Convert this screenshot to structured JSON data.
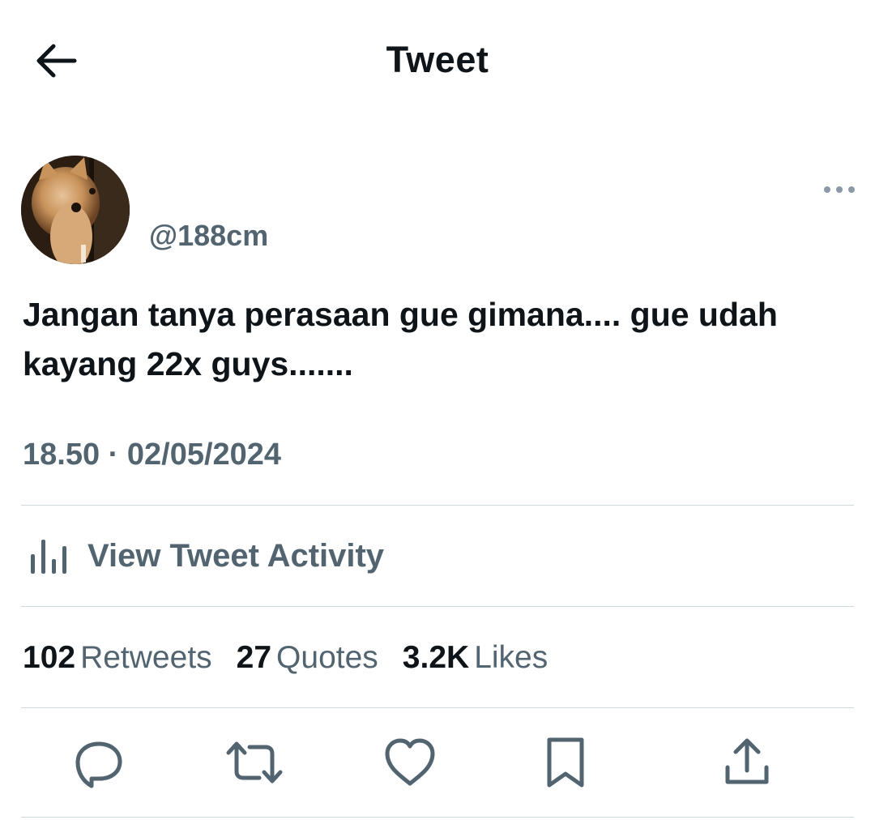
{
  "header": {
    "title": "Tweet",
    "back_icon": "arrow-left-icon"
  },
  "author": {
    "handle": "@188cm",
    "avatar": "cat-photo-avatar",
    "more_icon": "more-horizontal-icon"
  },
  "tweet": {
    "text": "Jangan tanya perasaan gue gimana.... gue udah kayang 22x guys.......",
    "timestamp": "18.50 · 02/05/2024"
  },
  "activity": {
    "label": "View Tweet Activity",
    "icon": "analytics-bars-icon"
  },
  "stats": {
    "retweets_count": "102",
    "retweets_label": "Retweets",
    "quotes_count": "27",
    "quotes_label": "Quotes",
    "likes_count": "3.2K",
    "likes_label": "Likes"
  },
  "actions": {
    "reply_icon": "reply-icon",
    "retweet_icon": "retweet-icon",
    "like_icon": "heart-icon",
    "bookmark_icon": "bookmark-icon",
    "share_icon": "share-icon"
  },
  "colors": {
    "text_primary": "#0f1419",
    "text_secondary": "#536471",
    "divider": "#cfd9de"
  }
}
